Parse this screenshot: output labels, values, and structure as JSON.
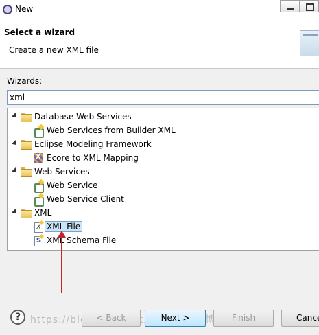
{
  "window": {
    "title": "New"
  },
  "banner": {
    "title": "Select a wizard",
    "description": "Create a new XML file"
  },
  "wizards": {
    "label": "Wizards:",
    "filter_value": "xml"
  },
  "tree": {
    "groups": [
      {
        "label": "Database Web Services",
        "children": [
          "Web Services from Builder XML"
        ]
      },
      {
        "label": "Eclipse Modeling Framework",
        "children": [
          "Ecore to XML Mapping"
        ]
      },
      {
        "label": "Web Services",
        "children": [
          "Web Service",
          "Web Service Client"
        ]
      },
      {
        "label": "XML",
        "children": [
          "XML File",
          "XML Schema File"
        ]
      }
    ],
    "selected": "XML File"
  },
  "buttons": {
    "help": "?",
    "back": "< Back",
    "next": "Next >",
    "finish": "Finish",
    "cancel": "Cance"
  },
  "watermark": "https://blog.csdn.net/...@51CTO博客",
  "colors": {
    "selection_bg": "#cce4f7",
    "annotation_arrow": "#c0272d",
    "default_button": "#bee6fd"
  }
}
